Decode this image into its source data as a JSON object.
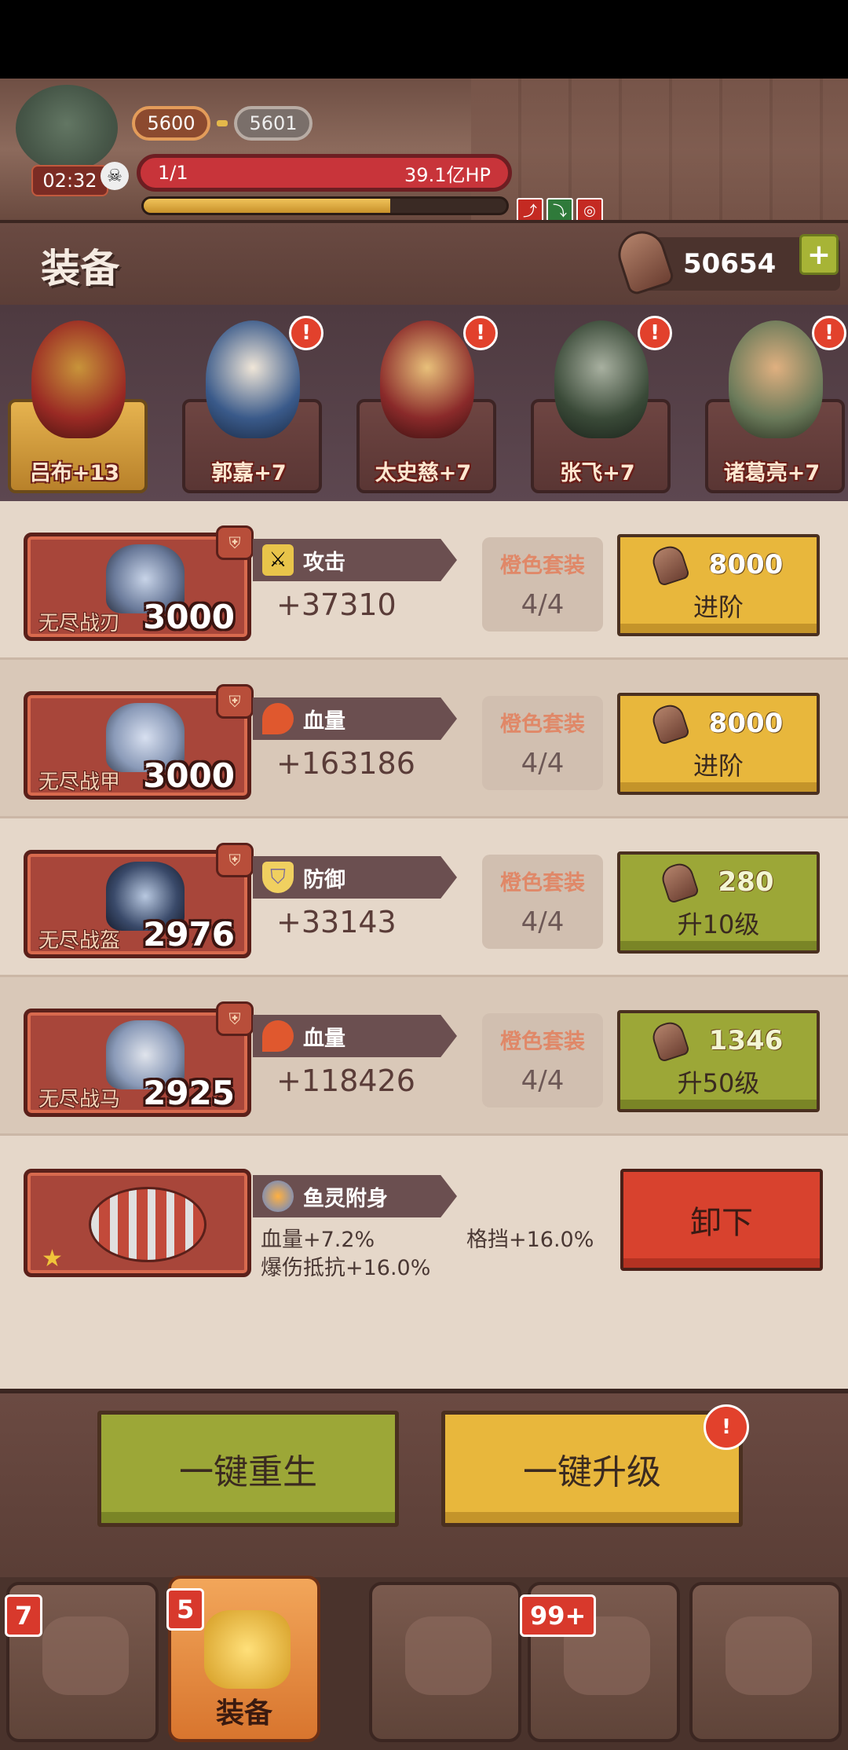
{
  "battle": {
    "level_current": "5600",
    "level_next": "5601",
    "timer": "02:32",
    "wave": "1/1",
    "boss_hp": "39.1亿HP",
    "progress_fraction": 0.68,
    "buffs": [
      "attack-buff-icon",
      "speed-buff-icon",
      "spiral-buff-icon"
    ]
  },
  "header": {
    "title": "装备",
    "currency_amount": "50654",
    "add_icon": "plus-icon"
  },
  "heroes": [
    {
      "name": "吕布+13",
      "active": true,
      "alert": false,
      "color": "#9a2a24"
    },
    {
      "name": "郭嘉+7",
      "active": false,
      "alert": true,
      "color": "#3a5a8a"
    },
    {
      "name": "太史慈+7",
      "active": false,
      "alert": true,
      "color": "#8a2a2a"
    },
    {
      "name": "张飞+7",
      "active": false,
      "alert": true,
      "color": "#3a4a38"
    },
    {
      "name": "诸葛亮+7",
      "active": false,
      "alert": true,
      "color": "#6a7a5a"
    }
  ],
  "equipment": [
    {
      "name": "无尽战刃",
      "level": "3000",
      "stat_label": "攻击",
      "stat_value": "+37310",
      "stat_icon": "sword-icon",
      "set_label": "橙色套装",
      "set_count": "4/4",
      "action_cost": "8000",
      "action_label": "进阶",
      "action_color": "yellow"
    },
    {
      "name": "无尽战甲",
      "level": "3000",
      "stat_label": "血量",
      "stat_value": "+163186",
      "stat_icon": "blood-drop-icon",
      "set_label": "橙色套装",
      "set_count": "4/4",
      "action_cost": "8000",
      "action_label": "进阶",
      "action_color": "yellow"
    },
    {
      "name": "无尽战盔",
      "level": "2976",
      "stat_label": "防御",
      "stat_value": "+33143",
      "stat_icon": "shield-icon",
      "set_label": "橙色套装",
      "set_count": "4/4",
      "action_cost": "280",
      "action_label": "升10级",
      "action_color": "green"
    },
    {
      "name": "无尽战马",
      "level": "2925",
      "stat_label": "血量",
      "stat_value": "+118426",
      "stat_icon": "blood-drop-icon",
      "set_label": "橙色套装",
      "set_count": "4/4",
      "action_cost": "1346",
      "action_label": "升50级",
      "action_color": "green"
    }
  ],
  "fish": {
    "title": "鱼灵附身",
    "stat_hp": "血量+7.2%",
    "stat_crit_resist": "爆伤抵抗+16.0%",
    "stat_block": "格挡+16.0%",
    "unload_label": "卸下"
  },
  "bottom": {
    "rebirth_label": "一键重生",
    "upgrade_label": "一键升级"
  },
  "tabs": [
    {
      "icon": "scroll-icon",
      "badge": "7",
      "label": ""
    },
    {
      "icon": "armor-icon",
      "badge": "5",
      "label": "装备",
      "active": true
    },
    {
      "icon": "stone-icon",
      "badge": "",
      "label": ""
    },
    {
      "icon": "chest-icon",
      "badge": "99+",
      "label": ""
    },
    {
      "icon": "map-icon",
      "badge": "",
      "label": ""
    }
  ]
}
